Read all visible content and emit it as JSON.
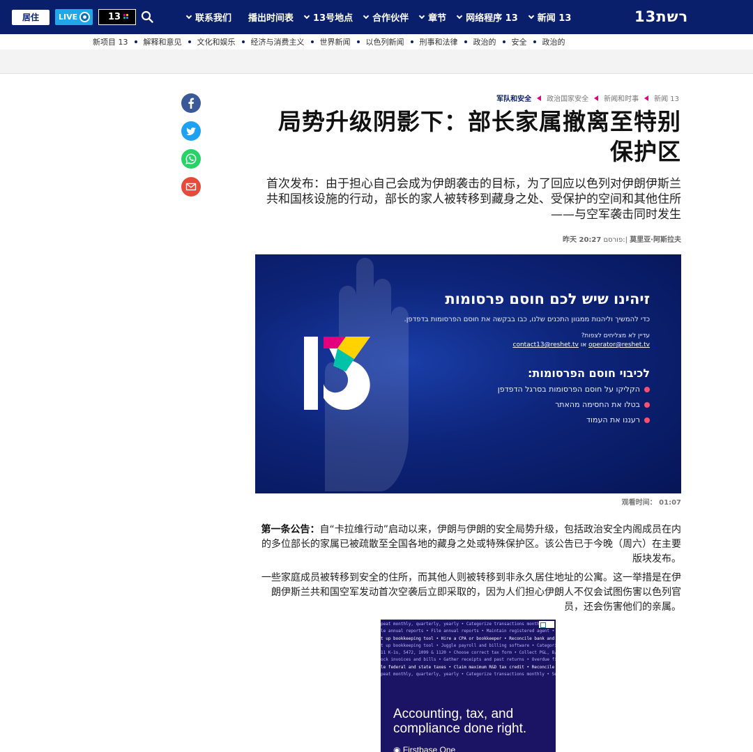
{
  "topbar": {
    "home_label": "居住",
    "live_label": "LIVE",
    "channel_label": "13",
    "nav": [
      {
        "label": "联系我们",
        "chevron": true
      },
      {
        "label": "播出时间表",
        "chevron": false
      },
      {
        "label": "13号地点",
        "chevron": true
      },
      {
        "label": "合作伙伴",
        "chevron": true
      },
      {
        "label": "章节",
        "chevron": true
      },
      {
        "label": "网络程序 13",
        "chevron": true
      },
      {
        "label": "新闻 13",
        "chevron": true
      }
    ],
    "logo": "רשת13"
  },
  "subnav": [
    "新项目 13",
    "解释和意见",
    "文化和娱乐",
    "经济与消费主义",
    "世界新闻",
    "以色列新闻",
    "刑事和法律",
    "政治的",
    "安全",
    "政治的"
  ],
  "breadcrumbs": [
    "军队和安全",
    "政治国家安全",
    "新闻和时事",
    "新闻 13"
  ],
  "article": {
    "headline": "局势升级阴影下：部长家属撤离至特别保护区",
    "subtitle": "首次发布：由于担心自己会成为伊朗袭击的目标，为了回应以色列对伊朗伊斯兰共和国核设施的行动，部长的家人被转移到藏身之处、受保护的空间和其他住所——与空军袭击同时发生",
    "byline_time": "昨天 20:27",
    "byline_posted": "פורסם:",
    "byline_author": "莫里亚·阿斯拉夫",
    "duration_label": "观看时间：",
    "duration_value": "01:07",
    "para1_lead": "第一条公告：",
    "para1_text": "自“卡拉维行动”启动以来，伊朗与伊朗的安全局势升级，包括政治安全内阁成员在内的多位部长的家属已被疏散至全国各地的藏身之处或特殊保护区。该公告已于今晚（周六）在主要版块发布。",
    "para2_text": "一些家庭成员被转移到安全的住所，而其他人则被转移到非永久居住地址的公寓。这一举措是在伊朗伊斯兰共和国空军发动首次空袭后立即采取的，因为人们担心伊朗人不仅会试图伤害以色列官员，还会伤害他们的亲属。"
  },
  "video": {
    "heading": "זיהינו שיש לכם חוסם פרסומות",
    "line1": "כדי להמשיך וליהנות ממגוון התכנים שלנו, כבו בבקשה את חוסם הפרסומות בדפדפן.",
    "line2": "עדיין לא מצליחים לצפות?",
    "email1": "contact13@reshet.tv",
    "email_or": "או",
    "email2": "operator@reshet.tv",
    "heading2": "לכיבוי חוסם הפרסומות:",
    "steps": [
      "הקליקו על חוסם הפרסומות בסרגל הדפדפן",
      "בטלו את החסימה מהאתר",
      "רעננו את העמוד"
    ]
  },
  "ad": {
    "lines": [
      "peat monthly, quarterly, yearly • Categorize transactions monthly •",
      "le annual reports • File annual reports • Maintain registered agent • Re",
      "t up bookkeeping tool • Hire a CPA or bookkeeper • Reconcile bank and c",
      "t up bookkeeping tool • Juggle payroll and billing software • Categoriz",
      "11 K-1s, 5472, 1099 & 1120 • Choose correct tax form • Collect P&L, B/S",
      "ock invoices and bills • Gather receipts and past returns • Overdue fili",
      "le federal and state taxes • Claim maximum R&D tax credit • Reconcile b",
      "peat monthly, quarterly, yearly • Categorize transactions monthly • Set"
    ],
    "headline": "Accounting, tax, and compliance done right.",
    "brand": "Firstbase One"
  },
  "colors": {
    "nav_bg": "#0a1f6b",
    "accent_pink": "#e4007c",
    "facebook": "#3b5998",
    "twitter": "#1da1f2",
    "whatsapp": "#25d366",
    "email": "#e64a3b"
  }
}
